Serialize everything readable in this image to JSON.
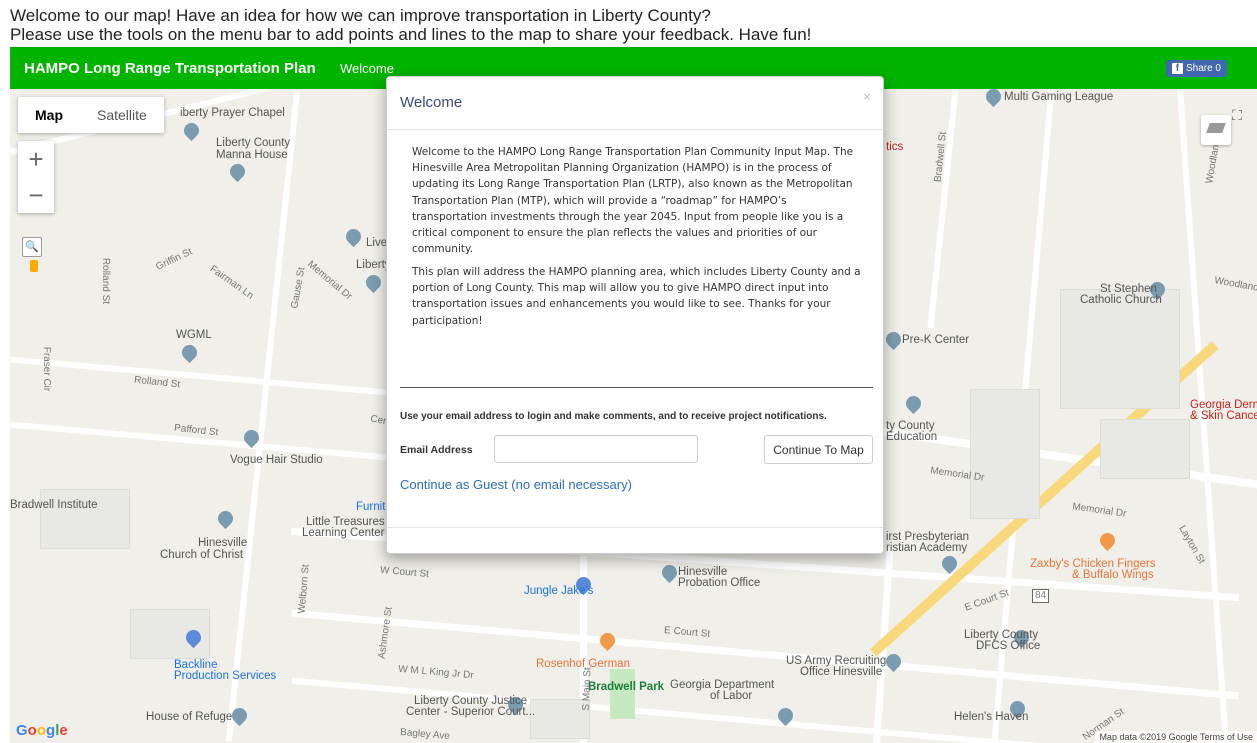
{
  "intro": {
    "line1": "Welcome to our map!  Have an idea for how we can improve transportation in Liberty County?",
    "line2": "Please use the tools on the menu bar to add points and lines to the map to share your feedback.  Have fun!"
  },
  "navbar": {
    "brand": "HAMPO Long Range Transportation Plan",
    "welcome_link": "Welcome",
    "share_label": "Share 0",
    "share_icon": "facebook-icon",
    "bg_color": "#00b400"
  },
  "map": {
    "type_tabs": [
      "Map",
      "Satellite"
    ],
    "active_tab": "Map",
    "zoom_in": "+",
    "zoom_out": "−",
    "search_icon": "search-icon",
    "pegman_icon": "pegman-icon",
    "fullscreen_icon": "fullscreen-icon",
    "layers_icon": "layers-icon",
    "attribution": "Map data ©2019 Google   Terms of Use",
    "logo": {
      "G": "G",
      "o1": "o",
      "o2": "o",
      "g": "g",
      "l": "l",
      "e": "e"
    },
    "labels": {
      "liberty_prayer_chapel": "iberty Prayer Chapel",
      "liberty_county_manna": "Liberty County",
      "manna_house": "Manna House",
      "multi_gaming": "Multi Gaming League",
      "griffin_st": "Griffin St",
      "fairman_ln": "Fairman Ln",
      "gause_st": "Gause St",
      "memorial_dr": "Memorial Dr",
      "roland_st": "Rolland St",
      "fraser_cir": "Fraser Cir",
      "rolland_st2": "Rolland St",
      "wgml": "WGML",
      "pafford_st": "Pafford St",
      "vogue": "Vogue Hair Studio",
      "bradwell_institute": "Bradwell Institute",
      "little_treasures": "Little Treasures",
      "learning_center": "Learning Center",
      "hinesville": "Hinesville",
      "church_christ": "Church of Christ",
      "w_court_st": "W Court St",
      "welborn_st": "Welborn St",
      "jungle_jakes": "Jungle Jake's",
      "hinesville_probation": "Hinesville",
      "probation_office": "Probation Office",
      "e_court_st": "E Court St",
      "backline": "Backline",
      "production_services": "Production Services",
      "ashmore_st": "Ashmore St",
      "wml_king": "W M L King Jr Dr",
      "rosenhof": "Rosenhof German",
      "bradwell_park": "Bradwell Park",
      "ga_dept": "Georgia Department",
      "of_labor": "of Labor",
      "us_army": "US Army Recruiting",
      "office_hinesville": "Office Hinesville",
      "house_refuge": "House of Refuge",
      "lc_justice": "Liberty County Justice",
      "superior": "Center - Superior Court...",
      "bagley_ave": "Bagley Ave",
      "helens_haven": "Helen's Haven",
      "lc_dfcs": "Liberty County",
      "dfcs_office": "DFCS Office",
      "zaxbys": "Zaxby's Chicken Fingers",
      "buffalo_wings": "& Buffalo Wings",
      "first_presby": "irst Presbyterian",
      "christian_academy": "ristian Academy",
      "pre_k": "Pre-K Center",
      "lc_education": "ty County",
      "education": "Education",
      "st_stephen": "St Stephen",
      "catholic": "Catholic Church",
      "woodland": "Woodland",
      "woodland_dr": "Woodland Dr",
      "georgia_derm": "Georgia Derm",
      "skin_cancer": "& Skin Cance",
      "bradwell_st": "Bradwell St",
      "memorial_dr2": "Memorial Dr",
      "memorial_dr3": "Memorial Dr",
      "layton_st": "Layton St",
      "e_court_st2": "E Court St",
      "central_av": "Central A",
      "furni": "Furnit",
      "lib": "Liberty",
      "live": "Live",
      "tics": "tics",
      "route_84": "84",
      "main_st": "S Main St",
      "norman_st": "Norman St"
    }
  },
  "modal": {
    "title": "Welcome",
    "close": "×",
    "paragraph1": "Welcome to the HAMPO Long Range Transportation Plan Community Input Map.  The Hinesville Area Metropolitan Planning Organization (HAMPO) is in the process of updating its Long Range Transportation Plan (LRTP), also known as the Metropolitan Transportation Plan (MTP), which will provide a “roadmap” for HAMPO’s transportation investments through the year 2045.  Input from people like you is a critical component to ensure the plan reflects the values and priorities of our community.",
    "paragraph2": "This plan will address the HAMPO planning area, which includes Liberty County and a portion of Long County.  This map will allow you to give HAMPO direct input into transportation issues and enhancements you would like to see.  Thanks for your participation!",
    "login_note": "Use your email address to login and make comments, and to receive project notifications.",
    "email_label": "Email Address",
    "email_value": "",
    "email_placeholder": "",
    "continue_button": "Continue To Map",
    "guest_link": "Continue as Guest (no email necessary)"
  }
}
